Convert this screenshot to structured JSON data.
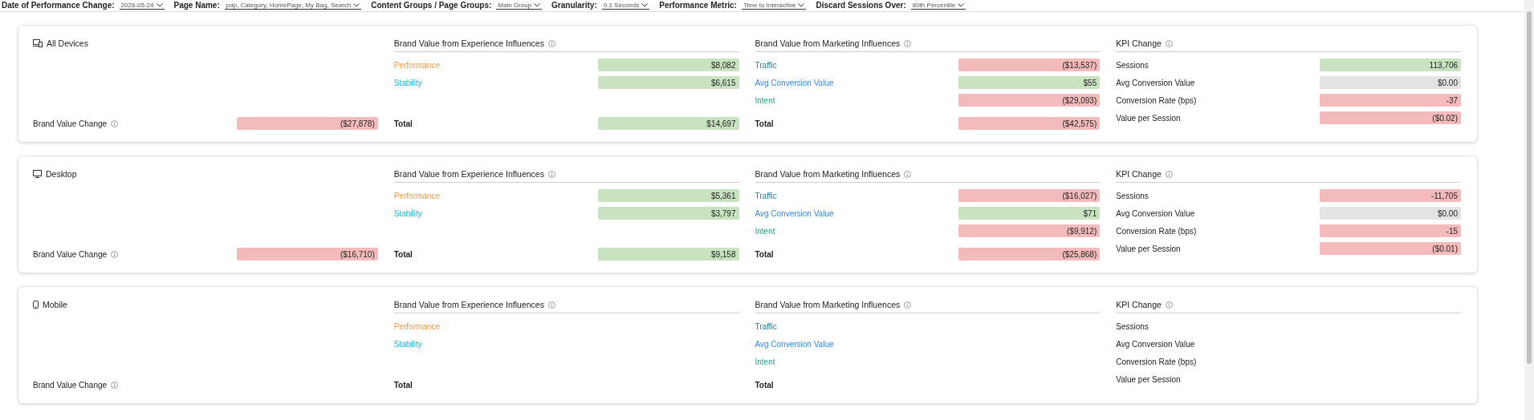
{
  "filters": [
    {
      "label": "Date of Performance Change:",
      "value": "2026-05-24"
    },
    {
      "label": "Page Name:",
      "value": "pdp, Category, HomePage, My Bag, Search"
    },
    {
      "label": "Content Groups / Page Groups:",
      "value": "Main Group"
    },
    {
      "label": "Granularity:",
      "value": "0.1 Seconds"
    },
    {
      "label": "Performance Metric:",
      "value": "Time to Interactive"
    },
    {
      "label": "Discard Sessions Over:",
      "value": "80th Percentile"
    }
  ],
  "cards": [
    {
      "device": {
        "name": "All Devices",
        "kind": "all"
      },
      "change": {
        "label": "Brand Value Change",
        "value": {
          "text": "($27,878)",
          "color": "#f3bbbb"
        }
      },
      "experience": {
        "title": "Brand Value from Experience Influences",
        "rows": [
          {
            "label": "Performance",
            "color": "#f39a4c",
            "value": {
              "text": "$8,082",
              "color": "#c9e2bf"
            }
          },
          {
            "label": "Stability",
            "color": "#22b5d4",
            "value": {
              "text": "$6,615",
              "color": "#c9e2bf"
            }
          }
        ],
        "total": {
          "label": "Total",
          "value": {
            "text": "$14,697",
            "color": "#c9e2bf"
          }
        }
      },
      "marketing": {
        "title": "Brand Value from Marketing Influences",
        "rows": [
          {
            "label": "Traffic",
            "color": "#1d7f9c",
            "value": {
              "text": "($13,537)",
              "color": "#f3bbbb"
            }
          },
          {
            "label": "Avg Conversion Value",
            "color": "#3b87e9",
            "value": {
              "text": "$55",
              "color": "#c9e2bf"
            }
          },
          {
            "label": "Intent",
            "color": "#27a38c",
            "value": {
              "text": "($29,093)",
              "color": "#f3bbbb"
            }
          }
        ],
        "total": {
          "label": "Total",
          "value": {
            "text": "($42,575)",
            "color": "#f3bbbb"
          }
        }
      },
      "kpi": {
        "title": "KPI Change",
        "rows": [
          {
            "label": "Sessions",
            "value": {
              "text": "113,706",
              "color": "#c9e2bf"
            }
          },
          {
            "label": "Avg Conversion Value",
            "value": {
              "text": "$0.00",
              "color": "#e3e3e3"
            }
          },
          {
            "label": "Conversion Rate (bps)",
            "value": {
              "text": "-37",
              "color": "#f3bbbb"
            }
          },
          {
            "label": "Value per Session",
            "value": {
              "text": "($0.02)",
              "color": "#f3bbbb"
            }
          }
        ]
      }
    },
    {
      "device": {
        "name": "Desktop",
        "kind": "desktop"
      },
      "change": {
        "label": "Brand Value Change",
        "value": {
          "text": "($16,710)",
          "color": "#f3bbbb"
        }
      },
      "experience": {
        "title": "Brand Value from Experience Influences",
        "rows": [
          {
            "label": "Performance",
            "color": "#f39a4c",
            "value": {
              "text": "$5,361",
              "color": "#c9e2bf"
            }
          },
          {
            "label": "Stability",
            "color": "#22b5d4",
            "value": {
              "text": "$3,797",
              "color": "#c9e2bf"
            }
          }
        ],
        "total": {
          "label": "Total",
          "value": {
            "text": "$9,158",
            "color": "#c9e2bf"
          }
        }
      },
      "marketing": {
        "title": "Brand Value from Marketing Influences",
        "rows": [
          {
            "label": "Traffic",
            "color": "#1d7f9c",
            "value": {
              "text": "($16,027)",
              "color": "#f3bbbb"
            }
          },
          {
            "label": "Avg Conversion Value",
            "color": "#3b87e9",
            "value": {
              "text": "$71",
              "color": "#c9e2bf"
            }
          },
          {
            "label": "Intent",
            "color": "#27a38c",
            "value": {
              "text": "($9,912)",
              "color": "#f3bbbb"
            }
          }
        ],
        "total": {
          "label": "Total",
          "value": {
            "text": "($25,868)",
            "color": "#f3bbbb"
          }
        }
      },
      "kpi": {
        "title": "KPI Change",
        "rows": [
          {
            "label": "Sessions",
            "value": {
              "text": "-11,705",
              "color": "#f3bbbb"
            }
          },
          {
            "label": "Avg Conversion Value",
            "value": {
              "text": "$0.00",
              "color": "#e3e3e3"
            }
          },
          {
            "label": "Conversion Rate (bps)",
            "value": {
              "text": "-15",
              "color": "#f3bbbb"
            }
          },
          {
            "label": "Value per Session",
            "value": {
              "text": "($0.01)",
              "color": "#f3bbbb"
            }
          }
        ]
      }
    },
    {
      "device": {
        "name": "Mobile",
        "kind": "mobile"
      },
      "change": {
        "label": "Brand Value Change"
      },
      "experience": {
        "title": "Brand Value from Experience Influences",
        "rows": [
          {
            "label": "Performance",
            "color": "#f39a4c"
          },
          {
            "label": "Stability",
            "color": "#22b5d4"
          }
        ],
        "total": {
          "label": "Total"
        }
      },
      "marketing": {
        "title": "Brand Value from Marketing Influences",
        "rows": [
          {
            "label": "Traffic",
            "color": "#1d7f9c"
          },
          {
            "label": "Avg Conversion Value",
            "color": "#3b87e9"
          },
          {
            "label": "Intent",
            "color": "#27a38c"
          }
        ],
        "total": {
          "label": "Total"
        }
      },
      "kpi": {
        "title": "KPI Change",
        "rows": [
          {
            "label": "Sessions"
          },
          {
            "label": "Avg Conversion Value"
          },
          {
            "label": "Conversion Rate (bps)"
          },
          {
            "label": "Value per Session"
          }
        ]
      }
    }
  ]
}
